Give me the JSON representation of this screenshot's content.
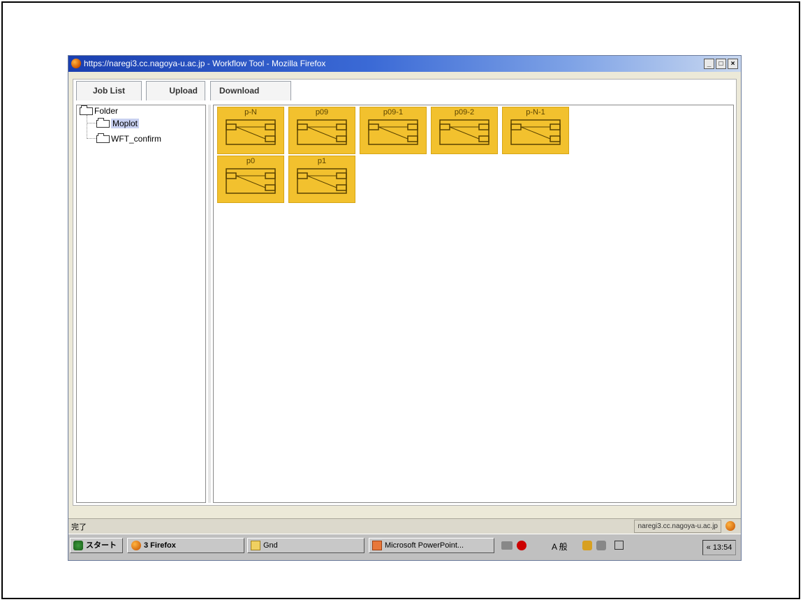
{
  "window": {
    "title": "https://naregi3.cc.nagoya-u.ac.jp - Workflow Tool - Mozilla Firefox",
    "min_glyph": "_",
    "max_glyph": "□",
    "close_glyph": "×"
  },
  "tabs": [
    {
      "label": "Job List"
    },
    {
      "label": "Upload"
    },
    {
      "label": "Download"
    }
  ],
  "tree": {
    "root": "Folder",
    "children": [
      "Moplot",
      "WFT_confirm"
    ],
    "selected": "Moplot"
  },
  "jobs": [
    "p-N",
    "p09",
    "p09-1",
    "p09-2",
    "p-N-1",
    "p0",
    "p1"
  ],
  "status": {
    "text": "完了",
    "host": "naregi3.cc.nagoya-u.ac.jp"
  },
  "taskbar": {
    "start": "スタート",
    "firefox": "3 Firefox",
    "gnd": "Gnd",
    "ppt": "Microsoft PowerPoint...",
    "ime": "A 般",
    "clock": "« 13:54"
  },
  "colors": {
    "job_fill": "#f2c12e",
    "titlebar": "#1a3fb0"
  }
}
